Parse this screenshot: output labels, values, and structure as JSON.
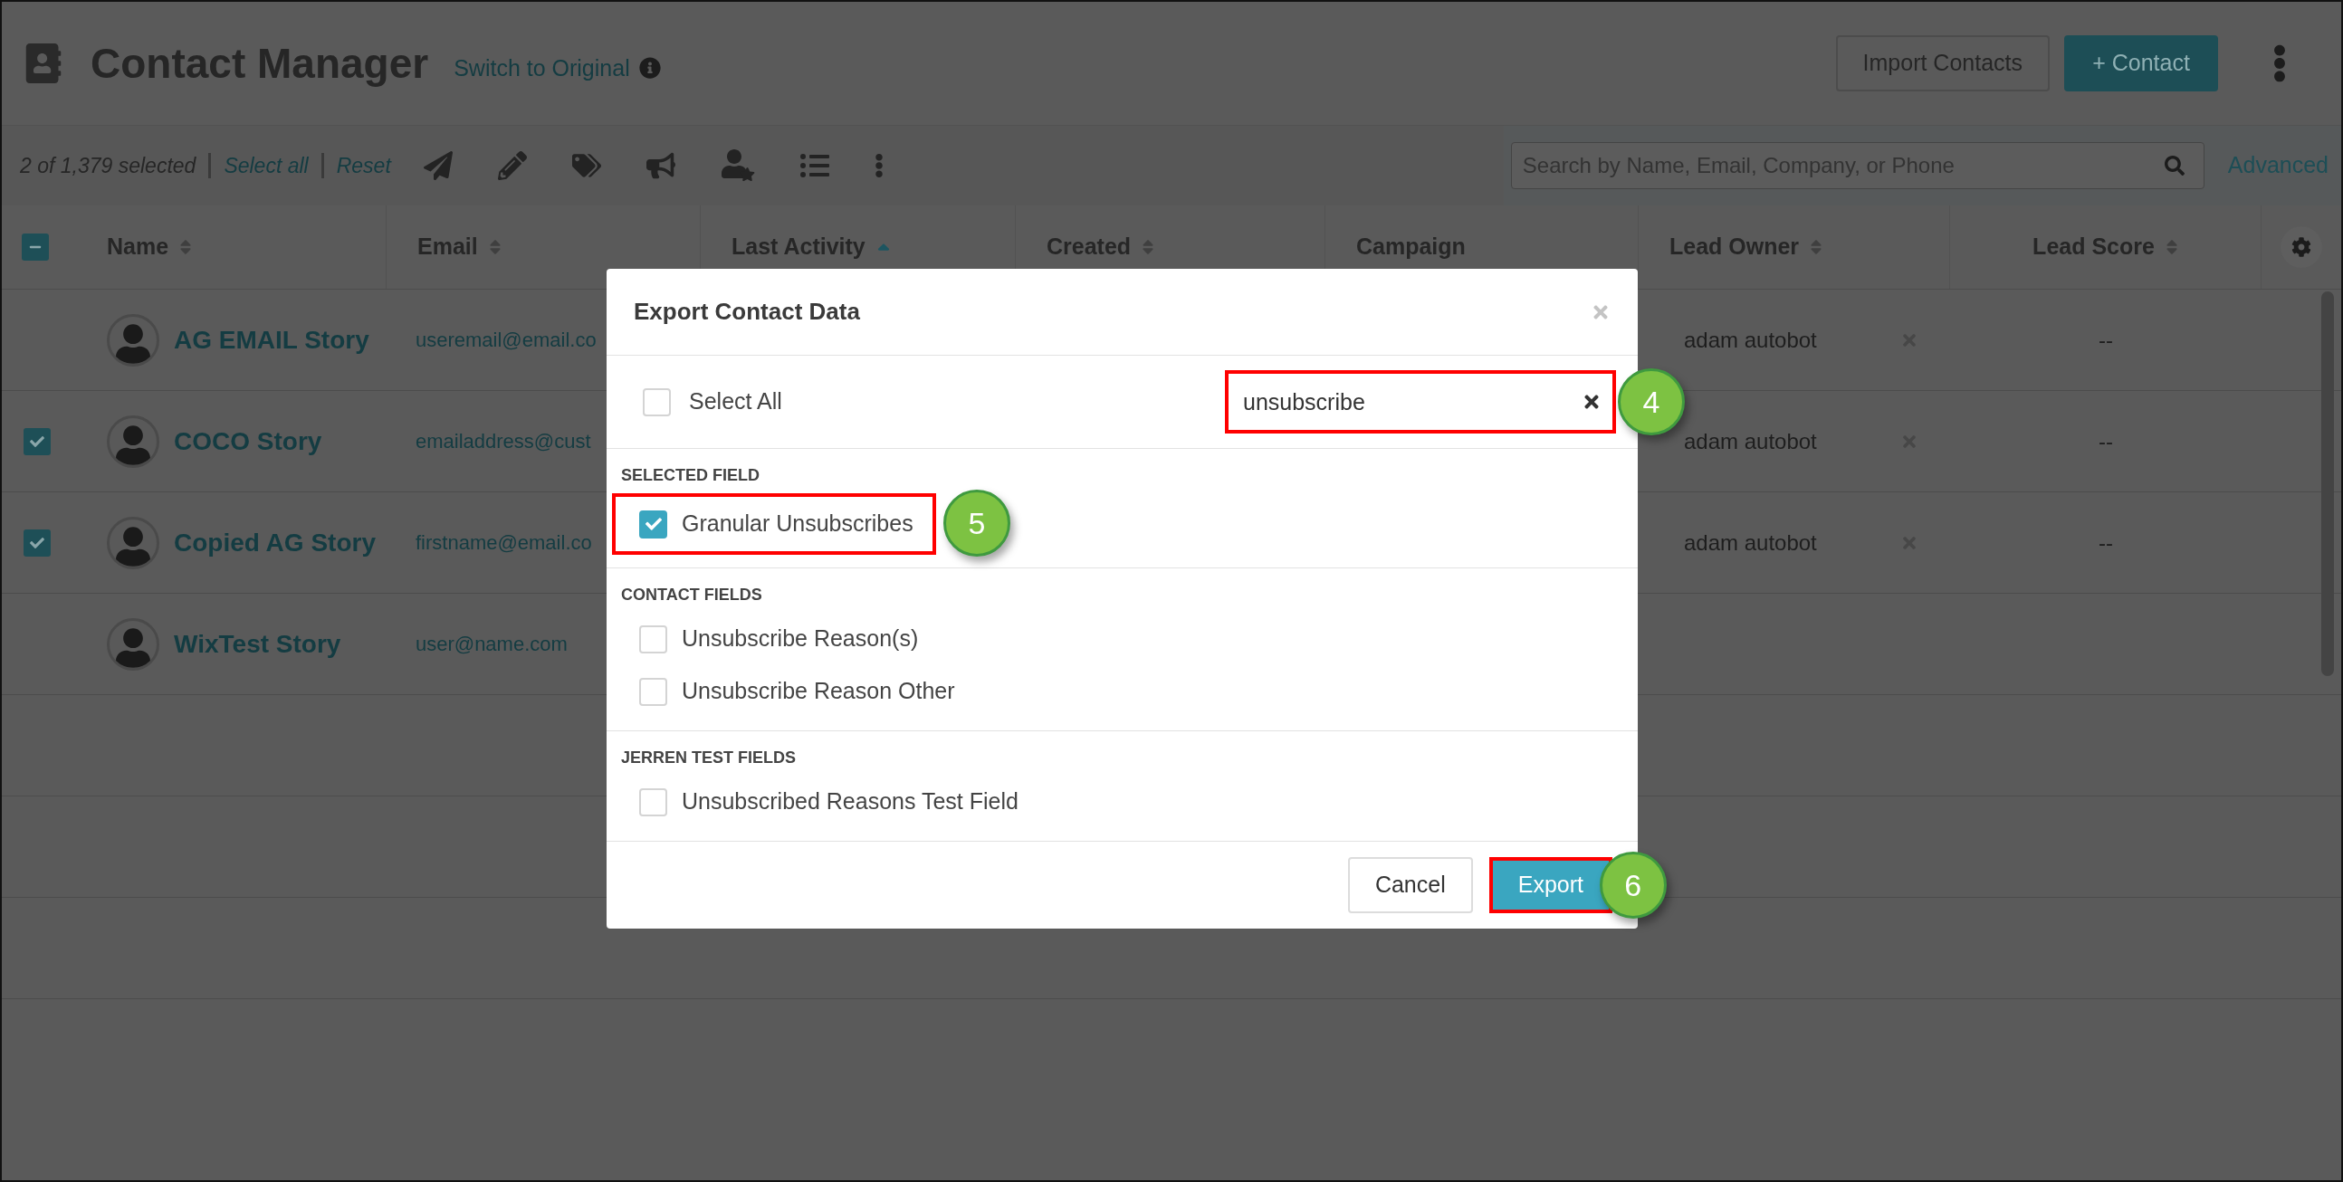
{
  "header": {
    "title": "Contact Manager",
    "switch_link": "Switch to Original",
    "import_button": "Import Contacts",
    "add_button": "+ Contact"
  },
  "toolbar": {
    "selection_count": "2 of 1,379 selected",
    "select_all": "Select all",
    "reset": "Reset",
    "search": {
      "placeholder": "Search by Name, Email, Company, or Phone"
    },
    "advanced": "Advanced"
  },
  "table": {
    "header_checkbox": {
      "indeterminate": true
    },
    "columns": [
      {
        "label": "Name",
        "sortable": true
      },
      {
        "label": "Email",
        "sortable": true
      },
      {
        "label": "Last Activity",
        "sortable": true,
        "sorted": true
      },
      {
        "label": "Created",
        "sortable": true
      },
      {
        "label": "Campaign",
        "sortable": false
      },
      {
        "label": "Lead Owner",
        "sortable": true
      },
      {
        "label": "Lead Score",
        "sortable": true
      }
    ],
    "rows": [
      {
        "checked": false,
        "name": "AG EMAIL Story",
        "email": "useremail@email.co",
        "lead_owner": "adam autobot",
        "lead_score": "--"
      },
      {
        "checked": true,
        "name": "COCO Story",
        "email": "emailaddress@cust",
        "lead_owner": "adam autobot",
        "lead_score": "--"
      },
      {
        "checked": true,
        "name": "Copied AG Story",
        "email": "firstname@email.co",
        "lead_owner": "adam autobot",
        "lead_score": "--"
      },
      {
        "checked": false,
        "name": "WixTest Story",
        "email": "user@name.com"
      }
    ]
  },
  "dialog": {
    "title": "Export Contact Data",
    "select_all": {
      "label": "Select All",
      "checked": false
    },
    "search": {
      "value": "unsubscribe",
      "highlighted": true,
      "callout": "4"
    },
    "sections": [
      {
        "label": "SELECTED FIELD",
        "fields": [
          {
            "label": "Granular Unsubscribes",
            "checked": true,
            "highlighted": true,
            "callout": "5"
          }
        ]
      },
      {
        "label": "CONTACT FIELDS",
        "fields": [
          {
            "label": "Unsubscribe Reason(s)",
            "checked": false,
            "highlighted": false
          },
          {
            "label": "Unsubscribe Reason Other",
            "checked": false,
            "highlighted": false
          }
        ]
      },
      {
        "label": "JERREN TEST FIELDS",
        "fields": [
          {
            "label": "Unsubscribed Reasons Test Field",
            "checked": false,
            "highlighted": false
          }
        ]
      }
    ],
    "buttons": [
      {
        "label": "Cancel",
        "kind": "secondary",
        "highlighted": false
      },
      {
        "label": "Export",
        "kind": "primary",
        "highlighted": true,
        "callout": "6"
      }
    ]
  }
}
